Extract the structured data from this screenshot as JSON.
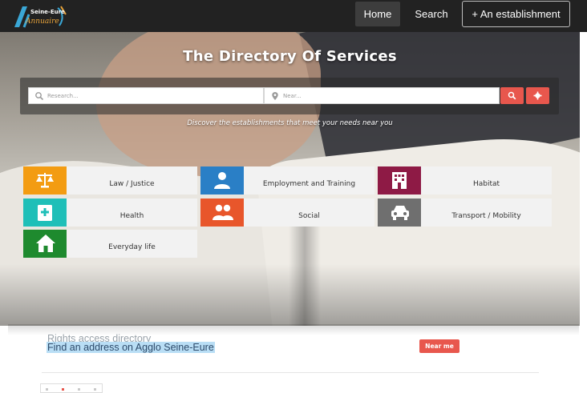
{
  "navbar": {
    "logo_top": "Seine-Eure",
    "logo_bottom": "Annuaire",
    "home": "Home",
    "search": "Search",
    "add": "+ An establishment"
  },
  "hero": {
    "title": "The Directory Of Services",
    "research_placeholder": "Research...",
    "near_placeholder": "Near...",
    "tagline": "Discover the establishments that meet your needs near you"
  },
  "categories": [
    {
      "label": "Law / Justice",
      "icon": "scales-icon",
      "color": "#f39c12"
    },
    {
      "label": "Employment and Training",
      "icon": "person-icon",
      "color": "#2a7fc6"
    },
    {
      "label": "Habitat",
      "icon": "building-icon",
      "color": "#8e1a45"
    },
    {
      "label": "Health",
      "icon": "medical-kit-icon",
      "color": "#1fbfb8"
    },
    {
      "label": "Social",
      "icon": "people-icon",
      "color": "#e8562b"
    },
    {
      "label": "Transport / Mobility",
      "icon": "car-icon",
      "color": "#6f6f6f"
    },
    {
      "label": "Everyday life",
      "icon": "home-icon",
      "color": "#1e8a2e"
    }
  ],
  "section": {
    "subtitle1": "Rights access directory",
    "subtitle2": "Find an address on Agglo Seine-Eure",
    "near_me": "Near me"
  },
  "colors": {
    "navbar": "#222222",
    "accent": "#e8574d"
  }
}
